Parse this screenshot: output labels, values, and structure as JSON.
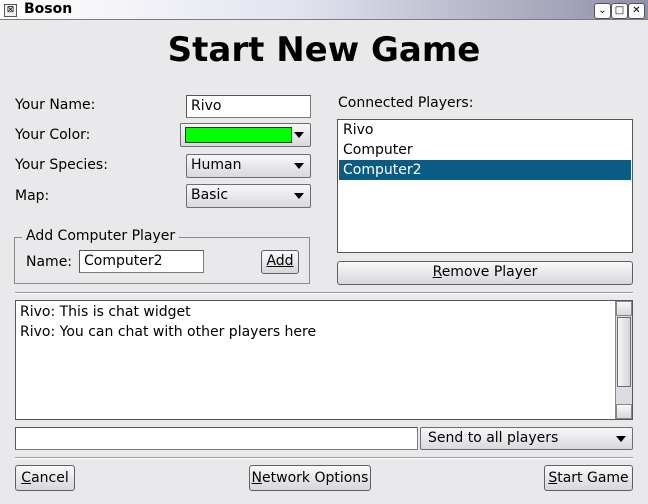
{
  "window": {
    "title": "Boson",
    "controls": [
      "menu",
      "maximize",
      "close"
    ]
  },
  "page_title": "Start New Game",
  "form": {
    "name_label": "Your Name:",
    "name_value": "Rivo",
    "color_label": "Your Color:",
    "color_value": "#00ff00",
    "species_label": "Your Species:",
    "species_value": "Human",
    "map_label": "Map:",
    "map_value": "Basic"
  },
  "computer_player": {
    "group_title": "Add Computer Player",
    "name_label": "Name:",
    "name_value": "Computer2",
    "add_label": "Add",
    "add_mnemonic": "A"
  },
  "players": {
    "label": "Connected Players:",
    "items": [
      "Rivo",
      "Computer",
      "Computer2"
    ],
    "selected_index": 2,
    "remove_label": "Remove Player",
    "remove_mnemonic": "R"
  },
  "chat": {
    "messages": [
      "Rivo: This is chat widget",
      "Rivo: You can chat with other players here"
    ],
    "input_value": "",
    "target": "Send to all players"
  },
  "footer": {
    "cancel_label": "Cancel",
    "cancel_mnemonic": "C",
    "network_label": "Network Options",
    "network_mnemonic": "N",
    "start_label": "Start Game",
    "start_mnemonic": "S"
  },
  "colors": {
    "selection": "#0b5c85",
    "player_color": "#00ff00"
  }
}
